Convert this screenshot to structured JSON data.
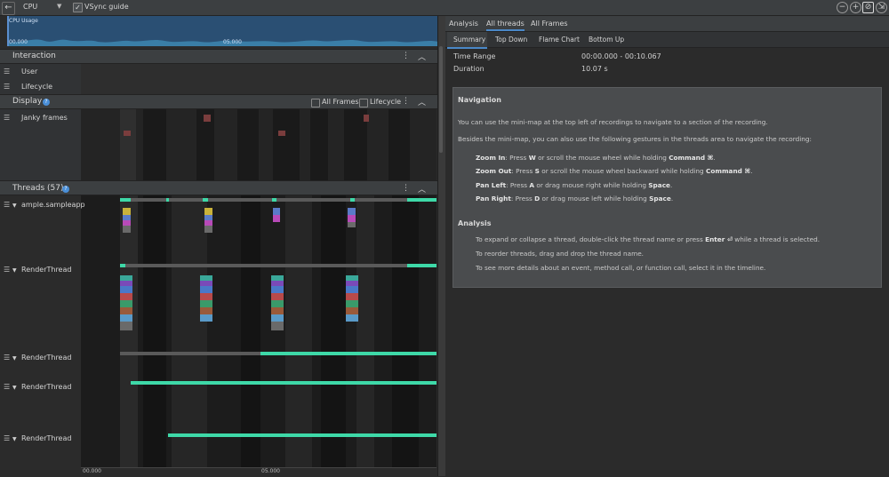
{
  "toolbar": {
    "back_icon": "arrow-left-icon",
    "profiler_select": "CPU",
    "vsync_checked": true,
    "vsync_label": "VSync guide",
    "zoom_out_icon": "minus-circle-icon",
    "zoom_in_icon": "plus-circle-icon",
    "reset_zoom_icon": "zoom-reset-icon",
    "attach_icon": "attach-icon"
  },
  "minimap": {
    "label": "CPU Usage",
    "tick0": "00.000",
    "tick1": "05.000"
  },
  "interaction": {
    "title": "Interaction",
    "rows": [
      "User",
      "Lifecycle"
    ]
  },
  "display": {
    "title": "Display",
    "all_frames_label": "All Frames",
    "lifecycle_label": "Lifecycle",
    "rows": [
      "Janky frames"
    ]
  },
  "threads": {
    "title": "Threads (57)",
    "rows": [
      "ample.sampleapp",
      "RenderThread",
      "RenderThread",
      "RenderThread",
      "RenderThread"
    ]
  },
  "timeline_axis": {
    "tick0": "00.000",
    "tick1": "05.000"
  },
  "right": {
    "tabs": [
      "Analysis",
      "All threads",
      "All Frames"
    ],
    "active_tab": "All threads",
    "subtabs": [
      "Summary",
      "Top Down",
      "Flame Chart",
      "Bottom Up"
    ],
    "active_subtab": "Summary",
    "summary": {
      "time_range_label": "Time Range",
      "time_range_value": "00:00.000 - 00:10.067",
      "duration_label": "Duration",
      "duration_value": "10.07 s"
    },
    "navigation": {
      "title": "Navigation",
      "p1": "You can use the mini-map at the top left of recordings to navigate to a section of the recording.",
      "p2": "Besides the mini-map, you can also use the following gestures in the threads area to navigate the recording:",
      "zoom_in": {
        "label": "Zoom In",
        "a": ": Press ",
        "key": "W",
        "b": " or scroll the mouse wheel while holding ",
        "mod": "Command ⌘",
        "c": "."
      },
      "zoom_out": {
        "label": "Zoom Out",
        "a": ": Press ",
        "key": "S",
        "b": " or scroll the mouse wheel backward while holding ",
        "mod": "Command ⌘",
        "c": "."
      },
      "pan_left": {
        "label": "Pan Left",
        "a": ": Press ",
        "key": "A",
        "b": " or drag mouse right while holding ",
        "mod": "Space",
        "c": "."
      },
      "pan_right": {
        "label": "Pan Right",
        "a": ": Press ",
        "key": "D",
        "b": " or drag mouse left while holding ",
        "mod": "Space",
        "c": "."
      }
    },
    "analysis": {
      "title": "Analysis",
      "l1a": "To expand or collapse a thread, double-click the thread name or press ",
      "l1key": "Enter ⏎",
      "l1b": " while a thread is selected.",
      "l2": "To reorder threads, drag and drop the thread name.",
      "l3": "To see more details about an event, method call, or function call, select it in the timeline."
    }
  },
  "colors": {
    "accent": "#4a88c7",
    "thread_green": "#3ed9a8",
    "minimap_bg": "#2a4f73"
  }
}
